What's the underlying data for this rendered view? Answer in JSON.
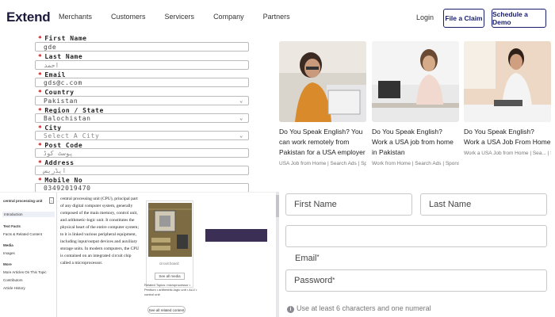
{
  "header": {
    "logo": "Extend",
    "nav": [
      "Merchants",
      "Customers",
      "Servicers",
      "Company",
      "Partners"
    ],
    "login": "Login",
    "file_claim": "File a Claim",
    "schedule_demo": "Schedule a Demo"
  },
  "left_form": {
    "fields": [
      {
        "label": "First Name",
        "value": "gde"
      },
      {
        "label": "Last Name",
        "value": "احمد"
      },
      {
        "label": "Email",
        "value": "gds@c.com"
      },
      {
        "label": "Country",
        "value": "Pakistan"
      },
      {
        "label": "Region / State",
        "value": "Balochistan"
      },
      {
        "label": "City",
        "value": "Select A City"
      },
      {
        "label": "Post Code",
        "value": "پوسٹ کوڈ"
      },
      {
        "label": "Address",
        "value": "ایڈریس"
      },
      {
        "label": "Mobile No",
        "value": "03492019470"
      }
    ]
  },
  "ads": [
    {
      "title": "Do You Speak English? You can work remotely from Pakistan for a USA employer",
      "source": "USA Job from Home | Search Ads | Sponsored"
    },
    {
      "title": "Do You Speak English? Work a USA job from home in Pakistan",
      "source": "Work from Home | Search Ads | Sponsored"
    },
    {
      "title": "Do You Speak English? Work a USA Job From Home",
      "source": "Work a USA Job from Home | Sea... | Sponsored"
    }
  ],
  "wiki": {
    "sidebar_title": "central processing unit",
    "sidebar_selected": "Introduction",
    "sidebar_items": [
      {
        "text": "Text Facts",
        "head": true
      },
      {
        "text": "Facts & Related Content",
        "head": false
      },
      {
        "text": "Media",
        "head": true
      },
      {
        "text": "Images",
        "head": false
      },
      {
        "text": "More",
        "head": true
      },
      {
        "text": "More Articles On This Topic",
        "head": false
      },
      {
        "text": "Contributors",
        "head": false
      },
      {
        "text": "Article History",
        "head": false
      }
    ],
    "body": "central processing unit (CPU), principal part of any digital computer system, generally composed of the main memory, control unit, and arithmetic-logic unit. It constitutes the physical heart of the entire computer system; to it is linked various peripheral equipment, including input/output devices and auxiliary storage units. In modern computers, the CPU is contained on an integrated circuit chip called a microprocessor.",
    "image_caption": "circuit board",
    "see_all_media": "See all media",
    "related": "Related Topics: microprocessor • Pentium • arithmetic-logic unit • ALU • control unit",
    "see_related": "See all related content →"
  },
  "right_form": {
    "first_name": "First Name",
    "last_name": "Last Name",
    "email": "Email",
    "password": "Password",
    "hint": "Use at least 6 characters and one numeral"
  },
  "colors": {
    "brand": "#1a1f6b",
    "required": "#cc0000"
  }
}
